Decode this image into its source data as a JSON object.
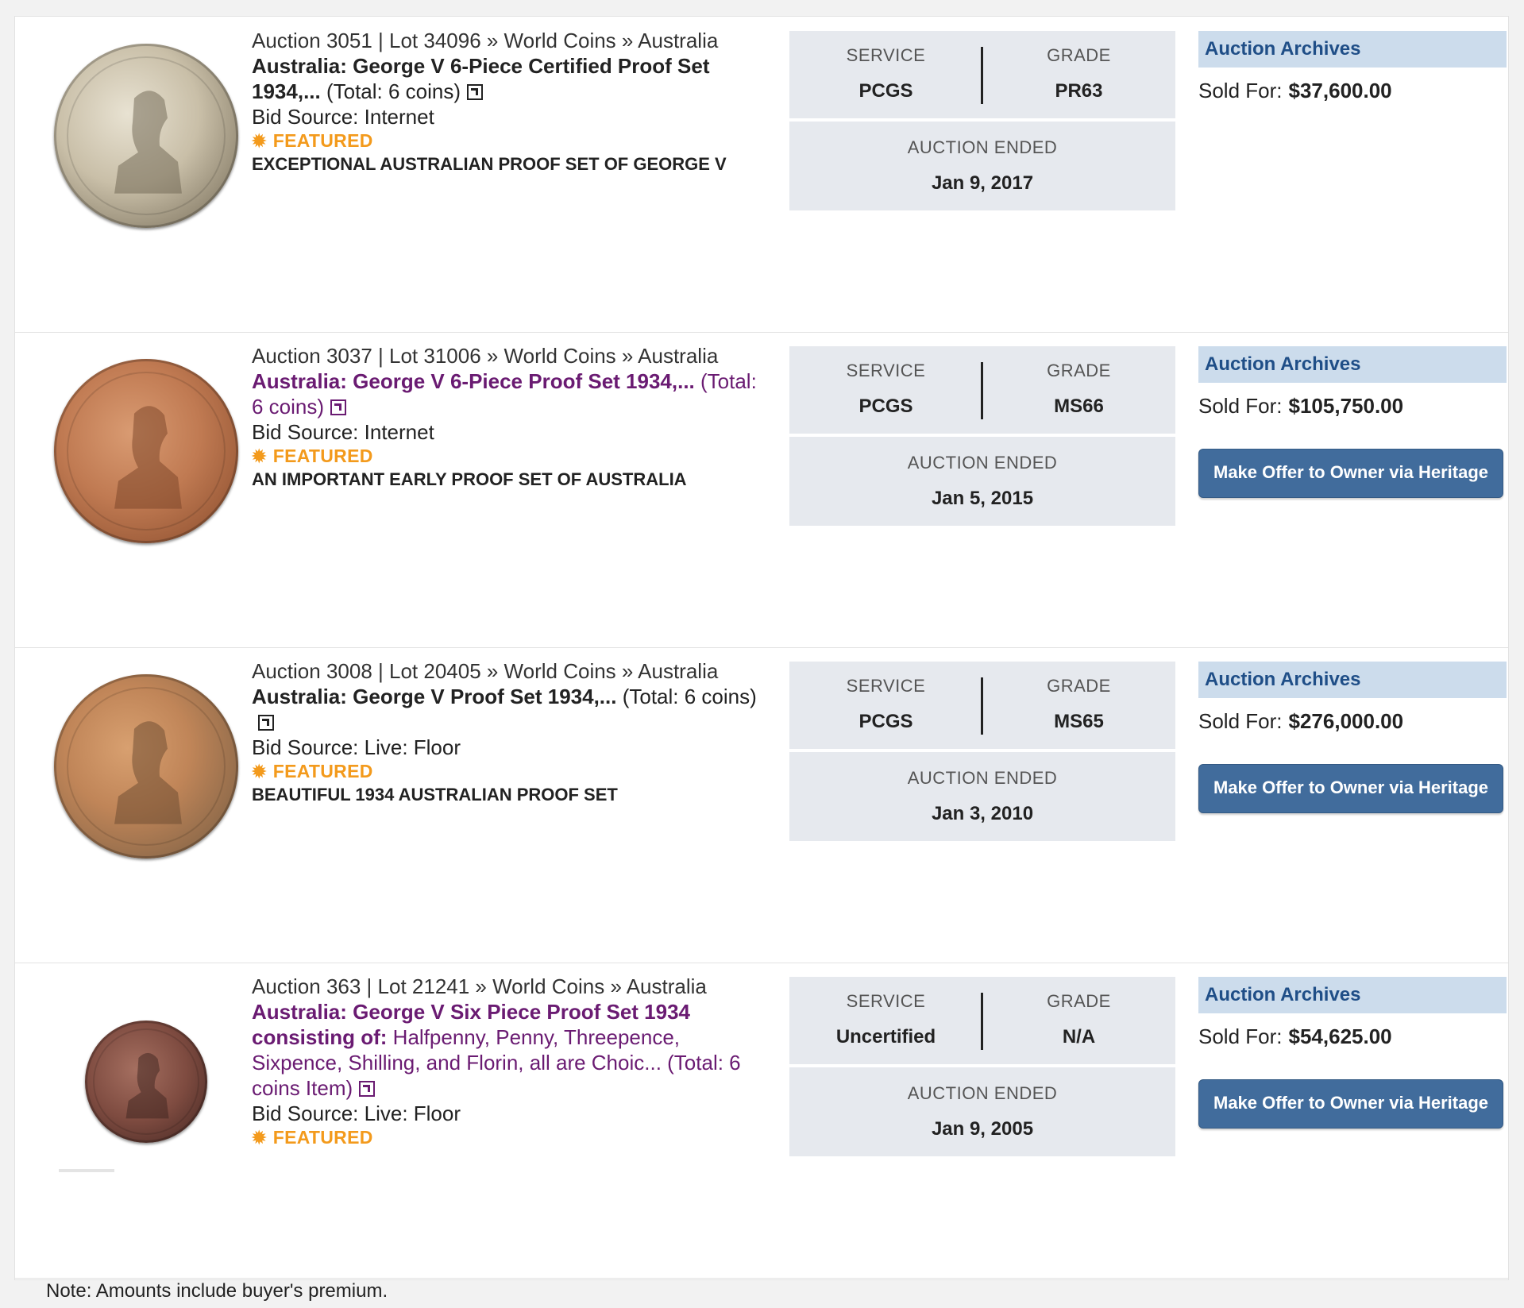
{
  "results": [
    {
      "crumb": "Auction 3051 | Lot 34096 » World Coins » Australia",
      "title_strong": "Australia: George V 6-Piece Certified Proof Set 1934,...",
      "title_rest": " (Total: 6 coins)",
      "bid_source": "Bid Source: Internet",
      "featured": "FEATURED",
      "headline": "EXCEPTIONAL AUSTRALIAN PROOF SET OF GEORGE V",
      "service_label": "SERVICE",
      "service": "PCGS",
      "grade_label": "GRADE",
      "grade": "PR63",
      "ended_label": "AUCTION ENDED",
      "ended": "Jan 9, 2017",
      "archives": "Auction Archives",
      "sold_label": "Sold For:",
      "sold_price": "$37,600.00",
      "offer_button": ""
    },
    {
      "crumb": "Auction 3037 | Lot 31006 » World Coins » Australia",
      "title_strong": "Australia: George V 6-Piece Proof Set 1934,...",
      "title_rest": " (Total: 6 coins)",
      "bid_source": "Bid Source: Internet",
      "featured": "FEATURED",
      "headline": "AN IMPORTANT EARLY PROOF SET OF AUSTRALIA",
      "service_label": "SERVICE",
      "service": "PCGS",
      "grade_label": "GRADE",
      "grade": "MS66",
      "ended_label": "AUCTION ENDED",
      "ended": "Jan 5, 2015",
      "archives": "Auction Archives",
      "sold_label": "Sold For:",
      "sold_price": "$105,750.00",
      "offer_button": "Make Offer to Owner via Heritage"
    },
    {
      "crumb": "Auction 3008 | Lot 20405 » World Coins » Australia",
      "title_strong": "Australia: George V Proof Set 1934,...",
      "title_rest": " (Total: 6 coins)",
      "bid_source": "Bid Source: Live: Floor",
      "featured": "FEATURED",
      "headline": "BEAUTIFUL 1934 AUSTRALIAN PROOF SET",
      "service_label": "SERVICE",
      "service": "PCGS",
      "grade_label": "GRADE",
      "grade": "MS65",
      "ended_label": "AUCTION ENDED",
      "ended": "Jan 3, 2010",
      "archives": "Auction Archives",
      "sold_label": "Sold For:",
      "sold_price": "$276,000.00",
      "offer_button": "Make Offer to Owner via Heritage"
    },
    {
      "crumb": "Auction 363 | Lot 21241 » World Coins » Australia",
      "title_strong": "Australia: George V Six Piece Proof Set 1934 consisting of:",
      "title_rest": " Halfpenny, Penny, Threepence, Sixpence, Shilling, and Florin, all are Choic... (Total: 6 coins Item)",
      "bid_source": "Bid Source: Live: Floor",
      "featured": "FEATURED",
      "headline": "",
      "service_label": "SERVICE",
      "service": "Uncertified",
      "grade_label": "GRADE",
      "grade": "N/A",
      "ended_label": "AUCTION ENDED",
      "ended": "Jan 9, 2005",
      "archives": "Auction Archives",
      "sold_label": "Sold For:",
      "sold_price": "$54,625.00",
      "offer_button": "Make Offer to Owner via Heritage"
    }
  ],
  "footer_note": "Note: Amounts include buyer's premium.",
  "colors": {
    "link_purple": "#6a1b72",
    "featured_orange": "#f39a1c",
    "archives_blue": "#1f4e87",
    "archives_bg": "#ccdcec",
    "button_blue": "#416c9c",
    "panel_gray": "#e6e9ee"
  },
  "icons": {
    "external_link": "external-link-icon",
    "featured": "star-burst-icon",
    "coin_image": "coin-image"
  }
}
